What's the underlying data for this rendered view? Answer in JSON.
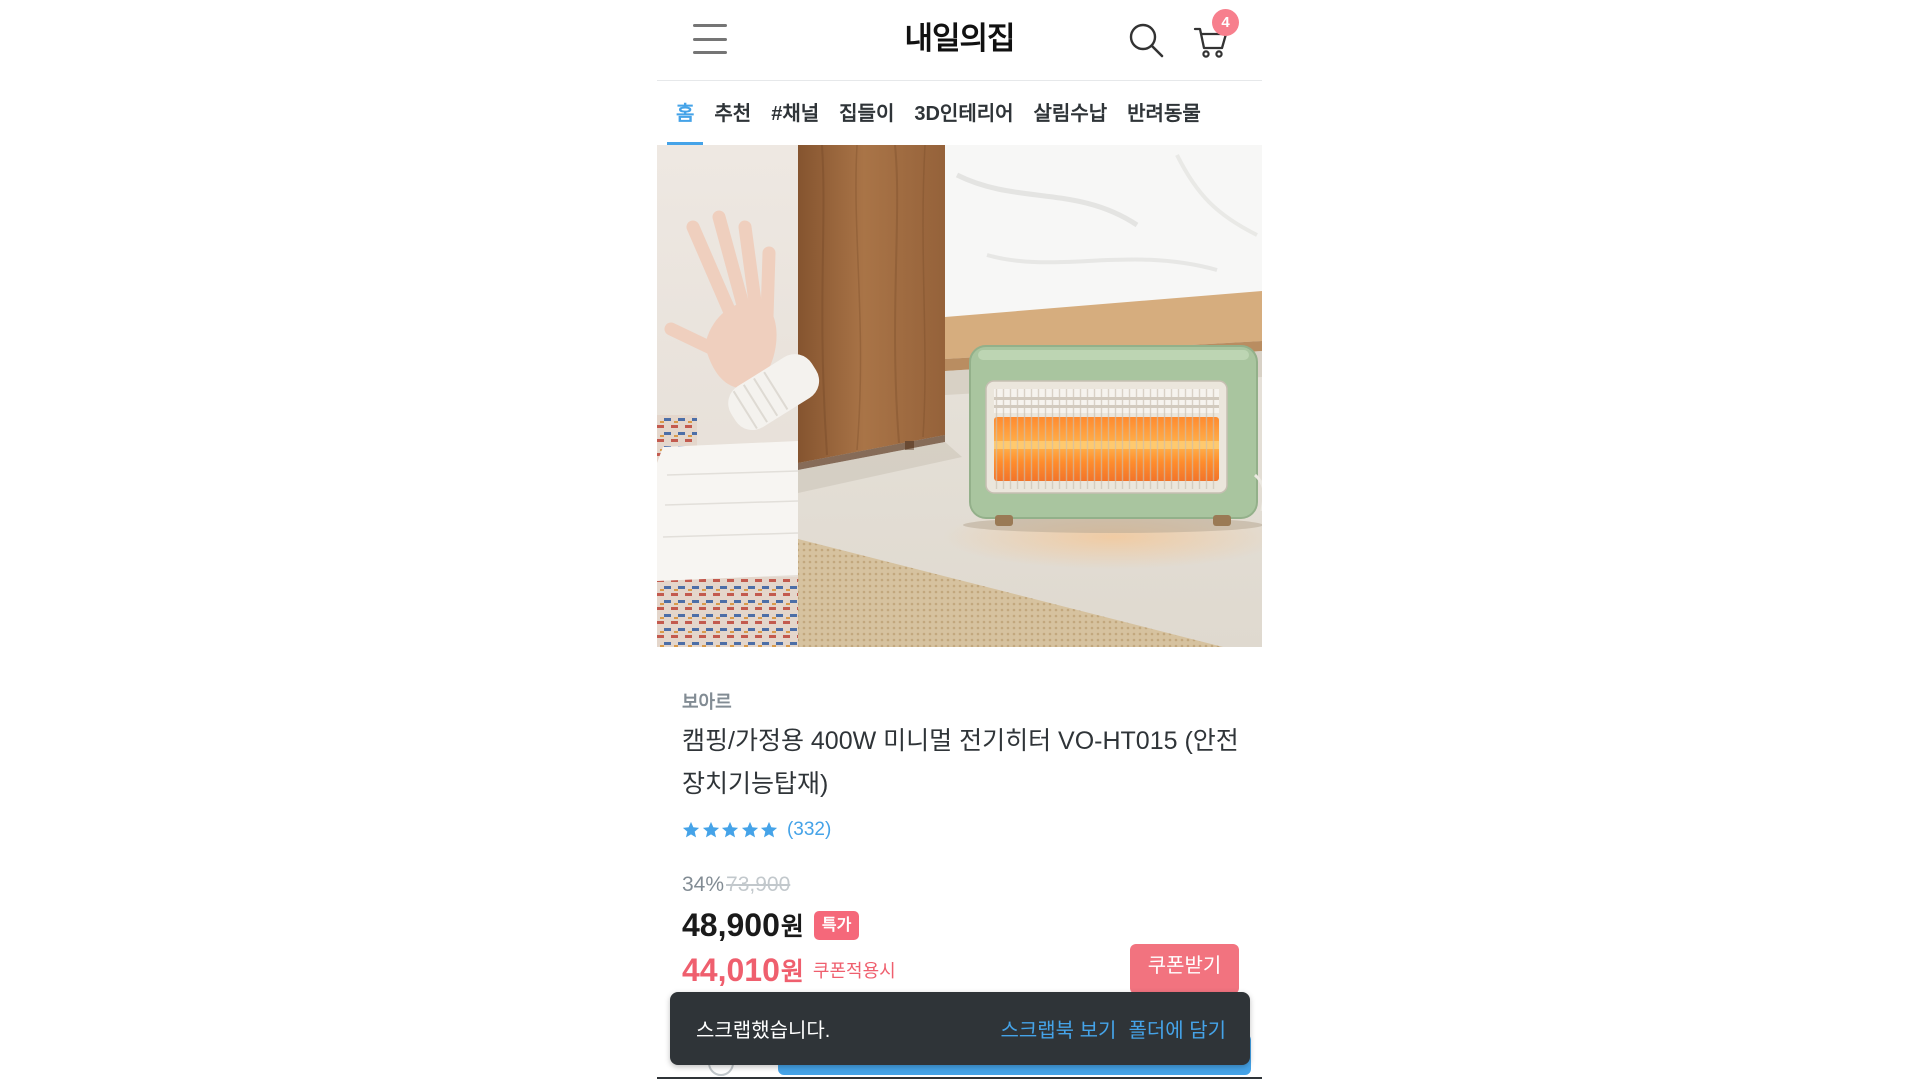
{
  "header": {
    "logo": "내일의집",
    "cart_badge_count": "4",
    "icons": {
      "menu": "hamburger-icon",
      "search": "search-icon",
      "cart": "cart-icon"
    }
  },
  "nav": {
    "tabs": [
      {
        "label": "홈",
        "active": true
      },
      {
        "label": "추천",
        "active": false
      },
      {
        "label": "#채널",
        "active": false
      },
      {
        "label": "집들이",
        "active": false
      },
      {
        "label": "3D인테리어",
        "active": false
      },
      {
        "label": "살림수납",
        "active": false
      },
      {
        "label": "반려동물",
        "active": false
      }
    ]
  },
  "product": {
    "brand": "보아르",
    "title": "캠핑/가정용 400W 미니멀 전기히터 VO-HT015 (안전장치기능탑재)",
    "rating_stars": 5,
    "review_count": "(332)",
    "discount_rate": "34%",
    "original_price": "73,900",
    "sale_price": "48,900",
    "sale_price_unit": "원",
    "sale_badge": "특가",
    "coupon_price": "44,010",
    "coupon_price_unit": "원",
    "coupon_note": "쿠폰적용시",
    "coupon_button": "쿠폰받기"
  },
  "toast": {
    "message": "스크랩했습니다.",
    "view_scrapbook": "스크랩북 보기",
    "save_to_folder": "폴더에 담기"
  },
  "colors": {
    "accent": "#45a3e8",
    "sale_pink": "#ef5f6e",
    "coupon_button": "#f2737f",
    "badge_red": "#f5687a",
    "cart_badge": "#f77f8d",
    "text_dark": "#2f3438",
    "text_gray": "#828c94",
    "toast_bg": "#2f3438"
  }
}
